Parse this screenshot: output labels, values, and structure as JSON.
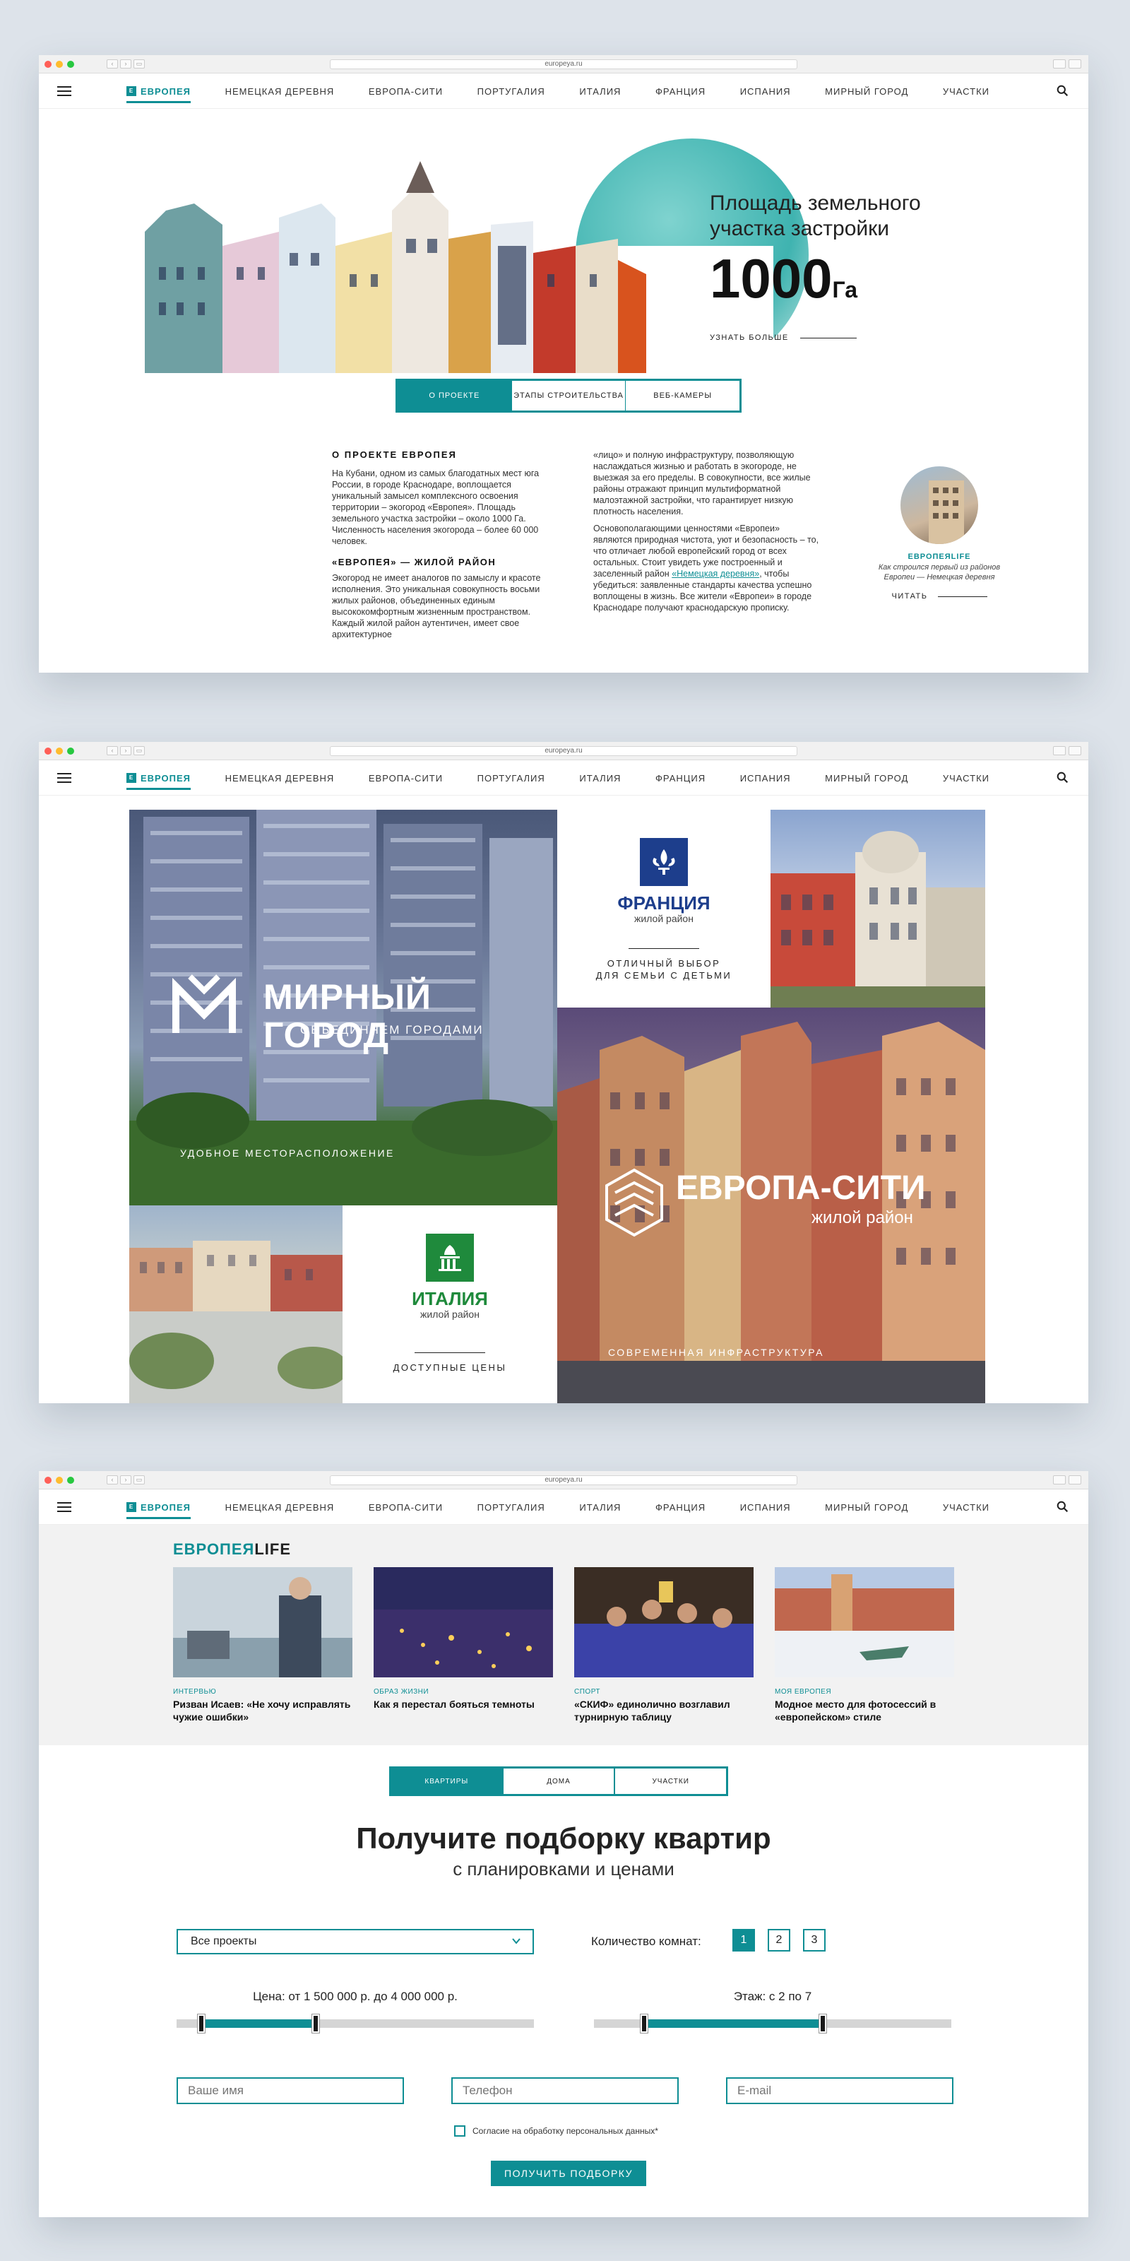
{
  "browser": {
    "url": "europeya.ru"
  },
  "nav": {
    "brand": "Европея",
    "brand_icon": "E",
    "items": [
      "Немецкая деревня",
      "Европа-Сити",
      "Португалия",
      "Италия",
      "Франция",
      "Испания",
      "Мирный город",
      "Участки"
    ]
  },
  "hero": {
    "heading": "Площадь земельного участка застройки",
    "value": "1000",
    "unit": "Га",
    "more_link": "УЗНАТЬ БОЛЬШЕ",
    "tabs": [
      "О ПРОЕКТЕ",
      "ЭТАПЫ СТРОИТЕЛЬСТВА",
      "ВЕБ-КАМЕРЫ"
    ]
  },
  "about": {
    "title": "О ПРОЕКТЕ ЕВРОПЕЯ",
    "p1": "На Кубани, одном из самых благодатных мест юга России, в городе Краснодаре, воплощается уникальный замысел комплексного освоения территории – экогород «Европея». Площадь земельного участка застройки – около 1000 Га. Численность населения экогорода – более 60 000 человек.",
    "subtitle": "«ЕВРОПЕЯ» — ЖИЛОЙ РАЙОН",
    "p2": "Экогород не имеет аналогов по замыслу и красоте исполнения. Это уникальная совокупность восьми жилых районов, объединенных единым высококомфортным жизненным пространством. Каждый жилой район аутентичен, имеет свое архитектурное",
    "p3": "«лицо» и полную инфраструктуру, позволяющую наслаждаться жизнью и работать в экогороде, не выезжая за его пределы. В совокупности, все жилые районы отражают принцип мультиформатной малоэтажной застройки, что гарантирует низкую плотность населения.",
    "p4a": "Основополагающими ценностями «Европеи» являются природная чистота, уют и безопасность – то, что отличает любой европейский город от всех остальных. Стоит увидеть уже построенный и заселенный район ",
    "p4link": "«Немецкая деревня»",
    "p4b": ", чтобы убедиться: заявленные стандарты качества успешно воплощены в жизнь. Все жители «Европеи» в городе Краснодаре получают краснодарскую прописку.",
    "side_label": "ЕВРОПЕЯLIFE",
    "side_text": "Как строился первый из районов Европеи — Немецкая деревня",
    "side_link": "ЧИТАТЬ"
  },
  "districts": {
    "mirny": {
      "title": "МИРНЫЙ ГОРОД",
      "subtitle": "ОБЪЕДИНЯЕМ ГОРОДАМИ",
      "caption": "УДОБНОЕ МЕСТОРАСПОЛОЖЕНИЕ"
    },
    "france": {
      "title": "ФРАНЦИЯ",
      "subtitle": "жилой район",
      "cta_line1": "ОТЛИЧНЫЙ ВЫБОР",
      "cta_line2": "ДЛЯ СЕМЬИ С ДЕТЬМИ"
    },
    "evrocity": {
      "title": "ЕВРОПА-СИТИ",
      "subtitle": "жилой район",
      "caption": "СОВРЕМЕННАЯ ИНФРАСТРУКТУРА"
    },
    "italy": {
      "title": "ИТАЛИЯ",
      "subtitle": "жилой район",
      "cta": "ДОСТУПНЫЕ ЦЕНЫ"
    }
  },
  "life": {
    "logo_a": "ЕВРОПЕЯ",
    "logo_b": "LIFE",
    "cards": [
      {
        "category": "ИНТЕРВЬЮ",
        "title": "Ризван Исаев: «Не хочу исправлять чужие ошибки»"
      },
      {
        "category": "ОБРАЗ ЖИЗНИ",
        "title": "Как я перестал бояться темноты"
      },
      {
        "category": "СПОРТ",
        "title": "«СКИФ» единолично возглавил турнирную таблицу"
      },
      {
        "category": "МОЯ ЕВРОПЕЯ",
        "title": "Модное место для фотосессий в «европейском» стиле"
      }
    ]
  },
  "form": {
    "tabs": [
      "КВАРТИРЫ",
      "ДОМА",
      "УЧАСТКИ"
    ],
    "title": "Получите подборку квартир",
    "subtitle": "с планировками и ценами",
    "project_select": "Все проекты",
    "rooms_label": "Количество комнат:",
    "rooms": [
      "1",
      "2",
      "3"
    ],
    "rooms_selected": 0,
    "price_label": "Цена: от 1 500 000 р. до 4 000 000 р.",
    "price_range_fraction": [
      0.07,
      0.39
    ],
    "floor_label": "Этаж: с 2 по 7",
    "floor_range_fraction": [
      0.14,
      0.64
    ],
    "name_placeholder": "Ваше имя",
    "phone_placeholder": "Телефон",
    "email_placeholder": "E-mail",
    "consent": "Согласие на обработку персональных данных*",
    "submit": "ПОЛУЧИТЬ ПОДБОРКУ"
  },
  "colors": {
    "accent": "#0e8e94"
  }
}
